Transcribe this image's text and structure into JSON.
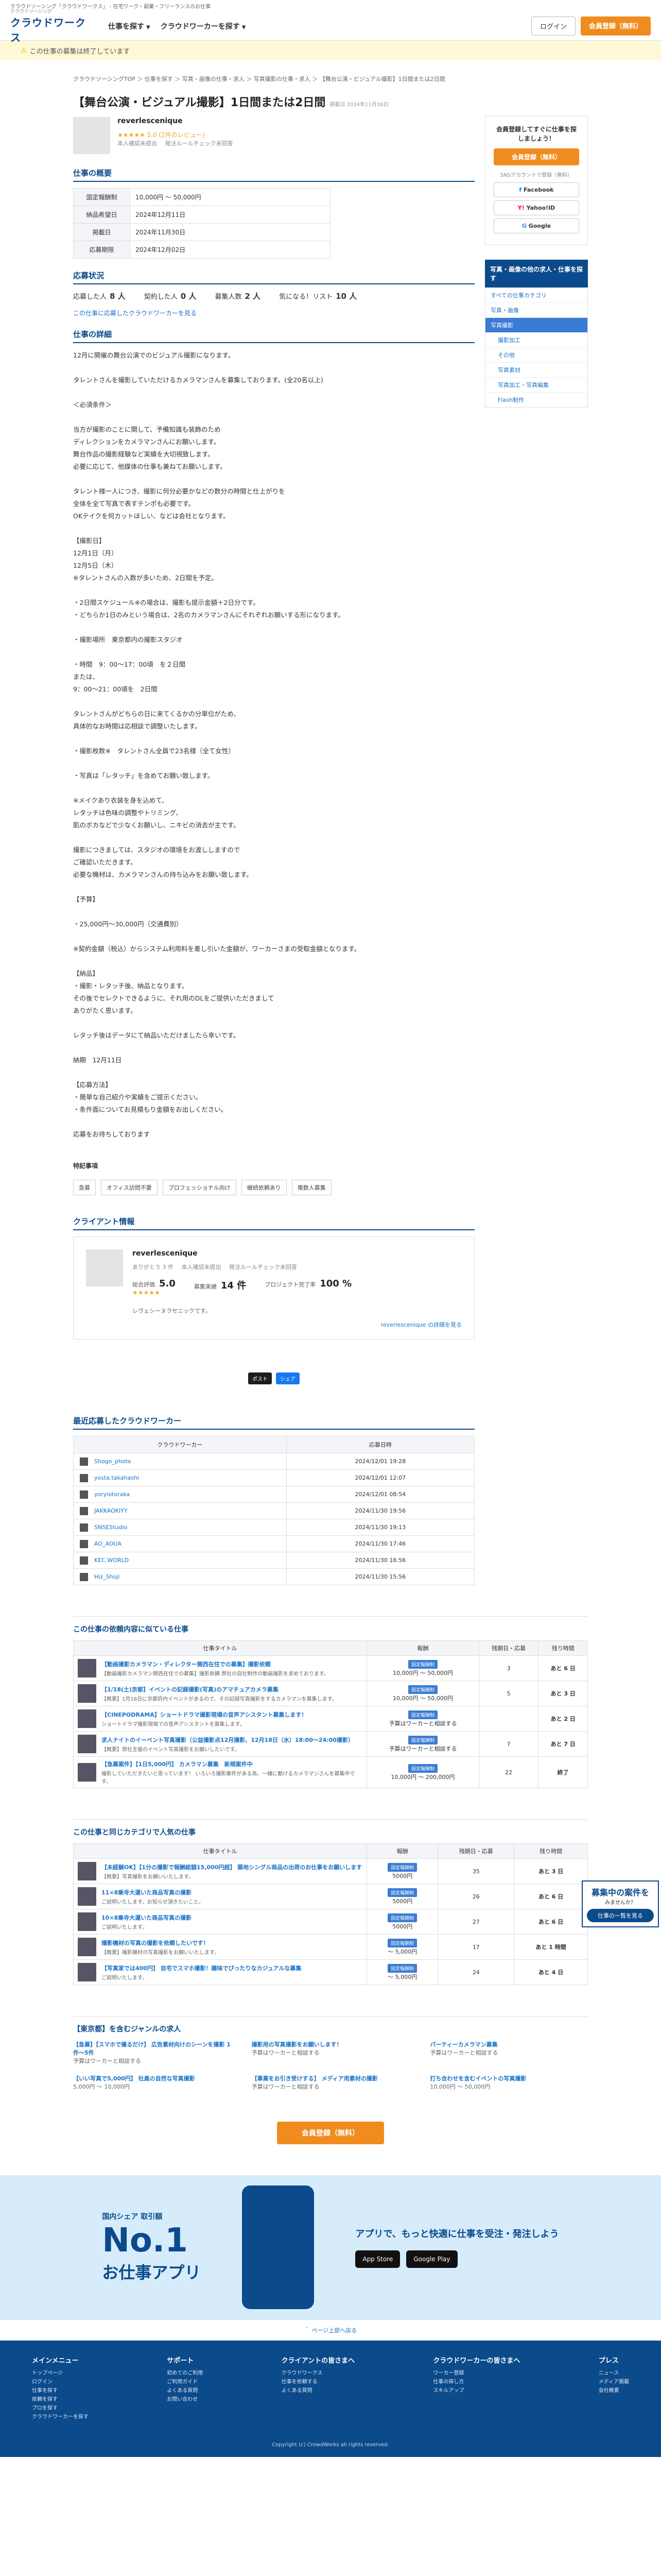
{
  "tagline": "クラウドソーシング「クラウドワークス」 - 在宅ワーク・副業・フリーランスのお仕事",
  "header": {
    "logo_small": "クラウドソーシング",
    "logo": "クラウドワークス",
    "nav_find_work": "仕事を探す",
    "nav_find_worker": "クラウドワーカーを探す",
    "login": "ログイン",
    "register": "会員登録（無料）"
  },
  "notice": "この仕事の募集は終了しています",
  "breadcrumb": "クラウドソーシングTOP ＞ 仕事を探す ＞ 写真・画像の仕事・求人 ＞ 写真撮影の仕事・求人 ＞ 【舞台公演・ビジュアル撮影】1日間または2日間",
  "job": {
    "title": "【舞台公演・ビジュアル撮影】1日間または2日間",
    "posted": "掲載日 2024年11月30日",
    "client_name": "reverlescenique",
    "rating": "★★★★★ 5.0 (2件のレビュー)",
    "meta_1": "本人確認未提出",
    "meta_2": "発注ルールチェック未回答"
  },
  "overview": {
    "heading": "仕事の概要",
    "rows": [
      {
        "k": "固定報酬制",
        "v": "10,000円 〜 50,000円"
      },
      {
        "k": "納品希望日",
        "v": "2024年12月11日"
      },
      {
        "k": "掲載日",
        "v": "2024年11月30日"
      },
      {
        "k": "応募期限",
        "v": "2024年12月02日"
      }
    ]
  },
  "apply": {
    "heading": "応募状況",
    "applicants_label": "応募した人",
    "applicants": "8 人",
    "contracted_label": "契約した人",
    "contracted": "0 人",
    "recruit_label": "募集人数",
    "recruit": "2 人",
    "favorites_label": "気になる！リスト",
    "favorites": "10 人",
    "link": "この仕事に応募したクラウドワーカーを見る"
  },
  "detail": {
    "heading": "仕事の詳細",
    "lines": [
      "12月に開催の舞台公演でのビジュアル撮影になります。",
      "",
      "タレントさんを撮影していただけるカメラマンさんを募集しております。(全20名以上)",
      "",
      "＜必須条件＞",
      "",
      "当方が撮影のことに関して、予備知識も装飾のため",
      "ディレクションをカメラマンさんにお願いします。",
      "舞台作品の撮影経験など実績を大切視致します。",
      "必要に応じて、他媒体の仕事も兼ねてお願いします。",
      "",
      "タレント様一人につき、撮影に何分必要かなどの数分の時間と仕上がりを",
      "全体を全て写真で表すテンポも必要です。",
      "OKテイクを何カットほしい、などは会社となります。",
      "",
      "【撮影日】",
      "12月1日（月）",
      "12月5日（木）",
      "※タレントさんの入数が多いため、2日間を予定。",
      "",
      "・2日間スケジュール※の場合は、撮影も提示金額＋2日分です。",
      "・どちらか1日のみという場合は、2名のカメラマンさんにそれぞれお願いする形になります。",
      "",
      "・撮影場所　東京都内の撮影スタジオ",
      "",
      "・時間　9：00〜17：00頃　を２日間",
      "または、",
      "9：00〜21：00頃を　2日間",
      "",
      "タレントさんがどちらの日に来てくるかの分単位がため、",
      "具体的なお時間は応相談で調整いたします。",
      "",
      "・撮影枚数※　タレントさん全員で23名様（全て女性）",
      "",
      "・写真は「レタッチ」を含めてお願い致します。",
      "",
      "※メイクあり衣装を身を込めて、",
      "レタッチは色味の調整やトリミング、",
      "肌のボカなどで少なくお願いし、ニキビの消去が主です。",
      "",
      "撮影につきましては、スタジオの環境をお渡ししますので",
      "ご確認いただきます。",
      "必要な機材は、カメラマンさんの持ち込みをお願い致します。",
      "",
      "【予算】",
      "",
      "・25,000円〜30,000円（交通費別）",
      "",
      "※契約金額（税込）からシステム利用料を差し引いた金額が、ワーカーさまの受取金額となります。",
      "",
      "【納品】",
      "・撮影・レタッチ後、納品となります。",
      "その後でセレクトできるように、それ用のDLをご提供いただきまして",
      "ありがたく思います。",
      "",
      "レタッチ後はデータにて納品いただけましたら幸いです。",
      "",
      "納期　12月11日",
      "",
      "【応募方法】",
      "・簡単な自己紹介や実績をご提示ください。",
      "・条件面についてお見積もり金額をお出しください。",
      "",
      "応募をお待ちしております"
    ]
  },
  "features": {
    "heading": "特記事項",
    "tags": [
      "急募",
      "オフィス訪問不要",
      "プロフェッショナル向け",
      "継続依頼あり",
      "複数人募集"
    ]
  },
  "client_info": {
    "heading": "クライアント情報",
    "name": "reverlescenique",
    "thanks": "ありがとう 3 件",
    "id_check": "本人確認未提出",
    "rule_check": "発注ルールチェック未回答",
    "rating_label": "総合評価",
    "rating": "5.0",
    "stars": "★★★★★",
    "jobs_label": "募集実績",
    "jobs": "14 件",
    "completion_label": "プロジェクト完了率",
    "completion": "100 %",
    "desc": "レヴェシーヌラセニックです。",
    "sub": "",
    "link": "reverlescenique の詳細を見る"
  },
  "share": {
    "x": "ポスト",
    "fb": "シェア"
  },
  "recent_workers": {
    "heading": "最近応募したクラウドワーカー",
    "col_worker": "クラウドワーカー",
    "col_date": "応募日時",
    "rows": [
      {
        "name": "Shogo_photo",
        "date": "2024/12/01 19:28"
      },
      {
        "name": "yosta.takahashi",
        "date": "2024/12/01 12:07"
      },
      {
        "name": "yoryiotoraka",
        "date": "2024/12/01 08:54"
      },
      {
        "name": "JAKKAOKIYY",
        "date": "2024/11/30 19:56"
      },
      {
        "name": "SNSEStudio",
        "date": "2024/11/30 19:13"
      },
      {
        "name": "AO_AOUA",
        "date": "2024/11/30 17:46"
      },
      {
        "name": "KEC WORLD",
        "date": "2024/11/30 16:56"
      },
      {
        "name": "Hiz_Shoji",
        "date": "2024/11/30 15:56"
      }
    ]
  },
  "client_jobs": {
    "heading": "この仕事の依頼内容に似ている仕事",
    "cols": [
      "仕事タイトル",
      "報酬",
      "残期日・応募",
      "残り時間"
    ],
    "rows": [
      {
        "title": "【動画撮影カメラマン・ディレクター関西在住での募集】撮影依頼",
        "desc": "【動画撮影カメラマン関西在住での募集】撮影依頼 弊社の自社制作の動画撮影を求めております。",
        "fee_type": "固定報酬制",
        "fee": "10,000円 〜 50,000円",
        "count": "3",
        "remaining": "あと 6 日"
      },
      {
        "title": "【1/18(土)京都】イベントの記録撮影(写真)のアマチュアカメラ募集",
        "desc": "【概要】1月18日に京都府内イベントがあるので、その記録写真撮影をするカメラマンを募集します。",
        "fee_type": "固定報酬制",
        "fee": "10,000円 〜 50,000円",
        "count": "5",
        "remaining": "あと 3 日"
      },
      {
        "title": "【CINEPODRAMA】ショートドラマ撮影現場の音声アシスタント募集します！",
        "desc": "ショートドラマ撮影現場での音声アシスタントを募集します。",
        "fee_type": "固定報酬制",
        "fee": "予算はワーカーと相談する",
        "count": "",
        "remaining": "あと 2 日"
      },
      {
        "title": "求人ナイトのイーベント写真撮影（公益撮影点12月撮影、12月18日（水）18:00〜24:00撮影）",
        "desc": "【概要】弊社主催のイベント写真撮影をお願いしたいです。",
        "fee_type": "固定報酬制",
        "fee": "予算はワーカーと相談する",
        "count": "7",
        "remaining": "あと 7 日"
      },
      {
        "title": "【急募案件】【1日5,000円】 カメラマン募集　新規案件中",
        "desc": "撮影していただきたいと思っています！ いろいろ撮影案件がある為、一緒に動けるカメラマンさんを募集中です。",
        "fee_type": "固定報酬制",
        "fee": "10,000円 〜 200,000円",
        "count": "22",
        "remaining": "終了"
      }
    ]
  },
  "similar_jobs": {
    "heading": "この仕事と同じカテゴリで人気の仕事",
    "cols": [
      "仕事タイトル",
      "報酬",
      "残期日・応募",
      "残り時間"
    ],
    "rows": [
      {
        "title": "【未経験OK】【1分の撮影で報酬総額15,000円超】 築地シングル商品の出荷のお仕事をお願いします",
        "desc": "【概要】写真撮影をお願いいたします。",
        "fee_type": "固定報酬制",
        "fee": "5000円",
        "count": "35",
        "remaining": "あと 3 日"
      },
      {
        "title": "11×8乗寺大運いた商品写真の撮影",
        "desc": "ご説明いたします。お知らせ頂きたいこと。",
        "fee_type": "固定報酬制",
        "fee": "5000円",
        "count": "26",
        "remaining": "あと 6 日"
      },
      {
        "title": "10×8乗寺大運いた商品写真の撮影",
        "desc": "ご説明いたします。",
        "fee_type": "固定報酬制",
        "fee": "5000円",
        "count": "27",
        "remaining": "あと 6 日"
      },
      {
        "title": "撮影機材の写真の撮影を依頼したいです！",
        "desc": "【概要】撮影機材の写真撮影をお願いいたします。",
        "fee_type": "固定報酬制",
        "fee": "〜 5,000円",
        "count": "17",
        "remaining": "あと 1 時間"
      },
      {
        "title": "【写真家では400円】 自宅でスマホ撮影！趣味でぴったりなカジュアルな募集",
        "desc": "ご説明いたします。",
        "fee_type": "固定報酬制",
        "fee": "〜 5,000円",
        "count": "24",
        "remaining": "あと 4 日"
      }
    ]
  },
  "other_jobs": {
    "heading": "【東京都】を含むジャンルの求人",
    "items": [
      {
        "title": "【急募】【スマホで撮るだけ】 広告素材向けのシーンを撮影 1件〜5件",
        "fee": "予算はワーカーと相談する"
      },
      {
        "title": "撮影用の写真撮影をお願いします！",
        "fee": "予算はワーカーと相談する"
      },
      {
        "title": "パーティーカメラマン募集",
        "fee": "予算はワーカーと相談する"
      },
      {
        "title": "【いい写真で5,000円】 社員の自然な写真撮影",
        "fee": "5,000円 〜 10,000円"
      },
      {
        "title": "【事業をお引き受けする】 メディア用素材の撮影",
        "fee": "予算はワーカーと相談する"
      },
      {
        "title": "打ち合わせを含むイベントの写真撮影",
        "fee": "10,000円 〜 50,000円"
      }
    ]
  },
  "cta_register": "会員登録（無料）",
  "floating_ad": {
    "title": "募集中の案件を",
    "sub": "みませんか？",
    "btn": "仕事の一覧を見る"
  },
  "app_banner": {
    "small": "国内シェア 取引額",
    "no1": "No.1",
    "title": "お仕事アプリ",
    "right_head": "アプリで、もっと快適に仕事を受注・発注しよう",
    "app_store": "App Store",
    "google_play": "Google Play"
  },
  "side": {
    "question": "会員登録してすぐに仕事を探しましょう！",
    "btn_register": "会員登録（無料）",
    "or": "SNSアカウントで登録（無料）",
    "facebook": "Facebook",
    "yahoo": "Yahoo!ID",
    "google": "Google",
    "category_head": "写真・画像の他の求人・仕事を探す",
    "categories": [
      {
        "label": "すべての仕事カテゴリ",
        "type": ""
      },
      {
        "label": "写真・画像",
        "type": ""
      },
      {
        "label": "写真撮影",
        "type": "active"
      },
      {
        "label": "撮影加工",
        "type": "sub"
      },
      {
        "label": "その他",
        "type": "sub"
      },
      {
        "label": "写真素材",
        "type": "sub"
      },
      {
        "label": "写真加工・写真編集",
        "type": "sub"
      },
      {
        "label": "Flash制作",
        "type": "sub"
      }
    ]
  },
  "page_top": "＾ ページ上部へ戻る",
  "footer": {
    "cols": [
      {
        "head": "メインメニュー",
        "items": [
          "トップページ",
          "ログイン",
          "仕事を探す",
          "依頼を探す",
          "プロを探す",
          "クラウドワーカーを探す"
        ]
      },
      {
        "head": "サポート",
        "items": [
          "初めてのご利用",
          "ご利用ガイド",
          "よくある質問",
          "お問い合わせ"
        ]
      },
      {
        "head": "クライアントの皆さまへ",
        "items": [
          "クラウドワークス",
          "仕事を依頼する",
          "よくある質問"
        ]
      },
      {
        "head": "クラウドワーカーの皆さまへ",
        "items": [
          "ワーカー登録",
          "仕事の探し方",
          "スキルアップ"
        ]
      },
      {
        "head": "プレス",
        "items": [
          "ニュース",
          "メディア掲載",
          "会社概要"
        ]
      }
    ],
    "copy": "Copyright (c) CrowdWorks all rights reserved."
  }
}
